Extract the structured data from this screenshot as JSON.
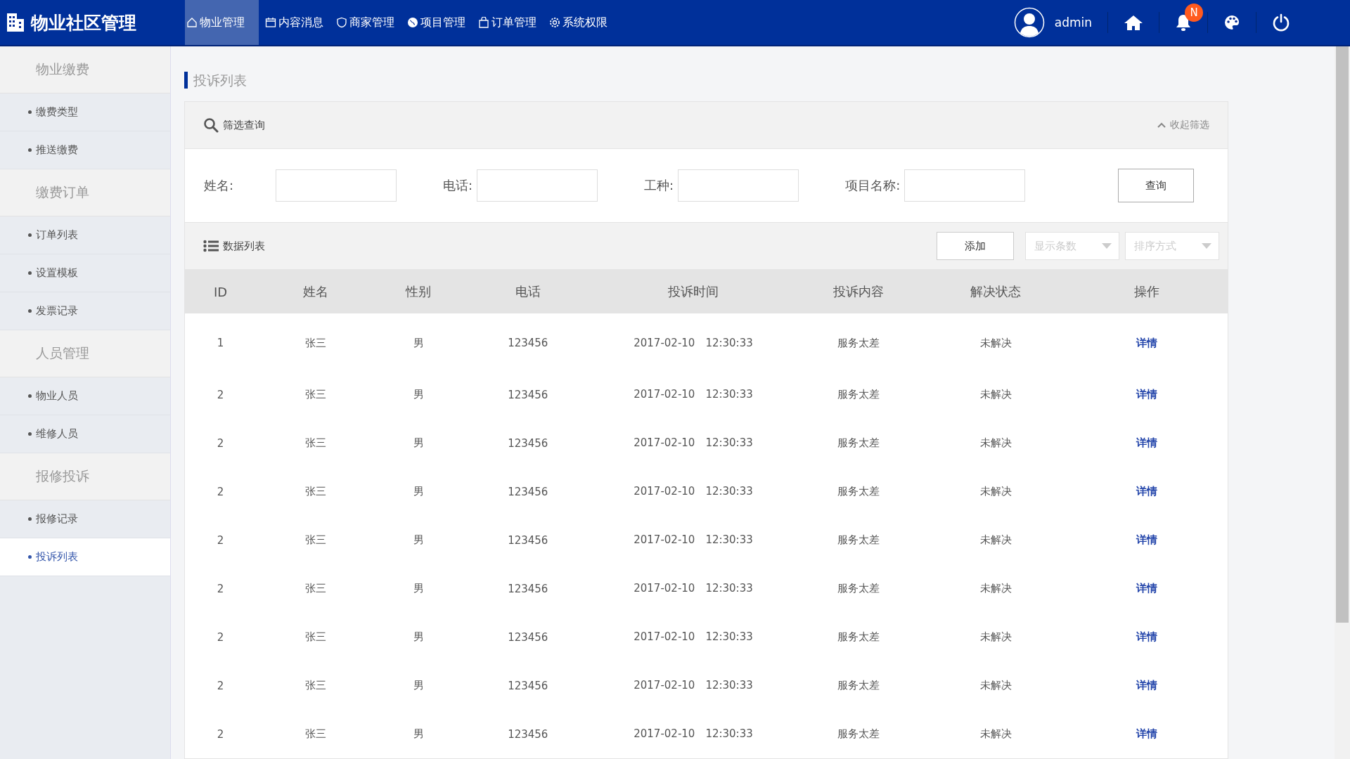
{
  "header": {
    "title": "物业社区管理",
    "nav": [
      {
        "label": "物业管理",
        "selected": true
      },
      {
        "label": "内容消息",
        "selected": false
      },
      {
        "label": "商家管理",
        "selected": false
      },
      {
        "label": "项目管理",
        "selected": false
      },
      {
        "label": "订单管理",
        "selected": false
      },
      {
        "label": "系统权限",
        "selected": false
      }
    ],
    "user": "admin",
    "badge": "N"
  },
  "sidebar": {
    "groups": [
      {
        "title": "物业缴费",
        "items": [
          {
            "label": "缴费类型",
            "selected": false
          },
          {
            "label": "推送缴费",
            "selected": false
          }
        ]
      },
      {
        "title": "缴费订单",
        "items": [
          {
            "label": "订单列表",
            "selected": false
          },
          {
            "label": "设置模板",
            "selected": false
          },
          {
            "label": "发票记录",
            "selected": false
          }
        ]
      },
      {
        "title": "人员管理",
        "items": [
          {
            "label": "物业人员",
            "selected": false
          },
          {
            "label": "维修人员",
            "selected": false
          }
        ]
      },
      {
        "title": "报修投诉",
        "items": [
          {
            "label": "报修记录",
            "selected": false
          },
          {
            "label": "投诉列表",
            "selected": true
          }
        ]
      }
    ]
  },
  "page_title": "投诉列表",
  "filter": {
    "title": "筛选查询",
    "collapse": "收起筛选",
    "fields": [
      {
        "label": "姓名:"
      },
      {
        "label": "电话:"
      },
      {
        "label": "工种:"
      },
      {
        "label": "项目名称:"
      }
    ],
    "button": "查询"
  },
  "list": {
    "title": "数据列表",
    "add_button": "添加",
    "dropdowns": [
      {
        "placeholder": "显示条数"
      },
      {
        "placeholder": "排序方式"
      }
    ]
  },
  "table": {
    "columns": [
      "ID",
      "姓名",
      "性别",
      "电话",
      "投诉时间",
      "投诉内容",
      "解决状态",
      "操作"
    ],
    "rows": [
      [
        "1",
        "张三",
        "男",
        "123456",
        "2017-02-10　12:30:33",
        "服务太差",
        "未解决",
        "详情"
      ],
      [
        "2",
        "张三",
        "男",
        "123456",
        "2017-02-10　12:30:33",
        "服务太差",
        "未解决",
        "详情"
      ],
      [
        "2",
        "张三",
        "男",
        "123456",
        "2017-02-10　12:30:33",
        "服务太差",
        "未解决",
        "详情"
      ],
      [
        "2",
        "张三",
        "男",
        "123456",
        "2017-02-10　12:30:33",
        "服务太差",
        "未解决",
        "详情"
      ],
      [
        "2",
        "张三",
        "男",
        "123456",
        "2017-02-10　12:30:33",
        "服务太差",
        "未解决",
        "详情"
      ],
      [
        "2",
        "张三",
        "男",
        "123456",
        "2017-02-10　12:30:33",
        "服务太差",
        "未解决",
        "详情"
      ],
      [
        "2",
        "张三",
        "男",
        "123456",
        "2017-02-10　12:30:33",
        "服务太差",
        "未解决",
        "详情"
      ],
      [
        "2",
        "张三",
        "男",
        "123456",
        "2017-02-10　12:30:33",
        "服务太差",
        "未解决",
        "详情"
      ],
      [
        "2",
        "张三",
        "男",
        "123456",
        "2017-02-10　12:30:33",
        "服务太差",
        "未解决",
        "详情"
      ]
    ]
  }
}
